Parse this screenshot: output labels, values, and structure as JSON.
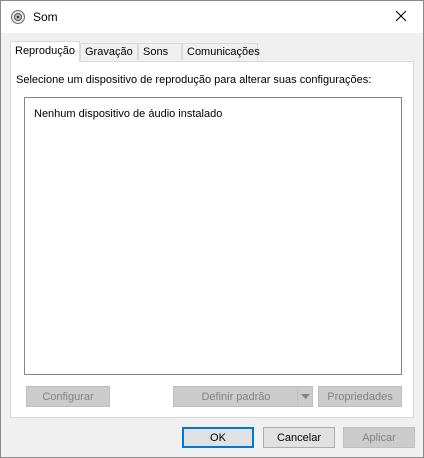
{
  "window": {
    "title": "Som",
    "icons": {
      "app": "speaker-icon",
      "close": "close-icon"
    }
  },
  "tabs": [
    {
      "label": "Reprodução",
      "active": true
    },
    {
      "label": "Gravação",
      "active": false
    },
    {
      "label": "Sons",
      "active": false
    },
    {
      "label": "Comunicações",
      "active": false
    }
  ],
  "panel": {
    "instruction": "Selecione um dispositivo de reprodução para alterar suas configurações:",
    "empty_message": "Nenhum dispositivo de áudio instalado",
    "buttons": {
      "configure": "Configurar",
      "set_default": "Definir padrão",
      "properties": "Propriedades"
    }
  },
  "dialog_buttons": {
    "ok": "OK",
    "cancel": "Cancelar",
    "apply": "Aplicar"
  },
  "colors": {
    "focus_border": "#0078d7",
    "disabled_text": "#838383"
  }
}
